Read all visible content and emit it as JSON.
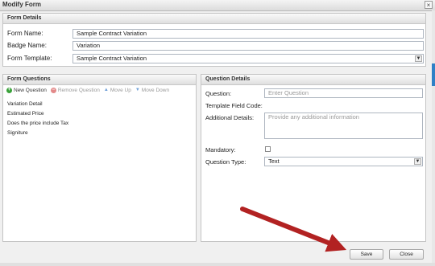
{
  "window": {
    "title": "Modify Form",
    "close_glyph": "×"
  },
  "form_details": {
    "header": "Form Details",
    "form_name_label": "Form Name:",
    "form_name_value": "Sample Contract Variation",
    "badge_name_label": "Badge Name:",
    "badge_name_value": "Variation",
    "form_template_label": "Form Template:",
    "form_template_value": "Sample Contract Variation"
  },
  "form_questions": {
    "header": "Form Questions",
    "toolbar": {
      "new": "New Question",
      "remove": "Remove Question",
      "move_up": "Move Up",
      "move_down": "Move Down"
    },
    "items": [
      "Variation Detail",
      "Estimated Price",
      "Does the price include Tax",
      "Signiture"
    ]
  },
  "question_details": {
    "header": "Question Details",
    "question_label": "Question:",
    "question_placeholder": "Enter Question",
    "template_field_code_label": "Template Field Code:",
    "additional_details_label": "Additional Details:",
    "additional_details_placeholder": "Provide any additional information",
    "mandatory_label": "Mandatory:",
    "question_type_label": "Question Type:",
    "question_type_value": "Text"
  },
  "buttons": {
    "save": "Save",
    "close": "Close"
  },
  "colors": {
    "arrow": "#b22222",
    "accent": "#2f80c6"
  }
}
